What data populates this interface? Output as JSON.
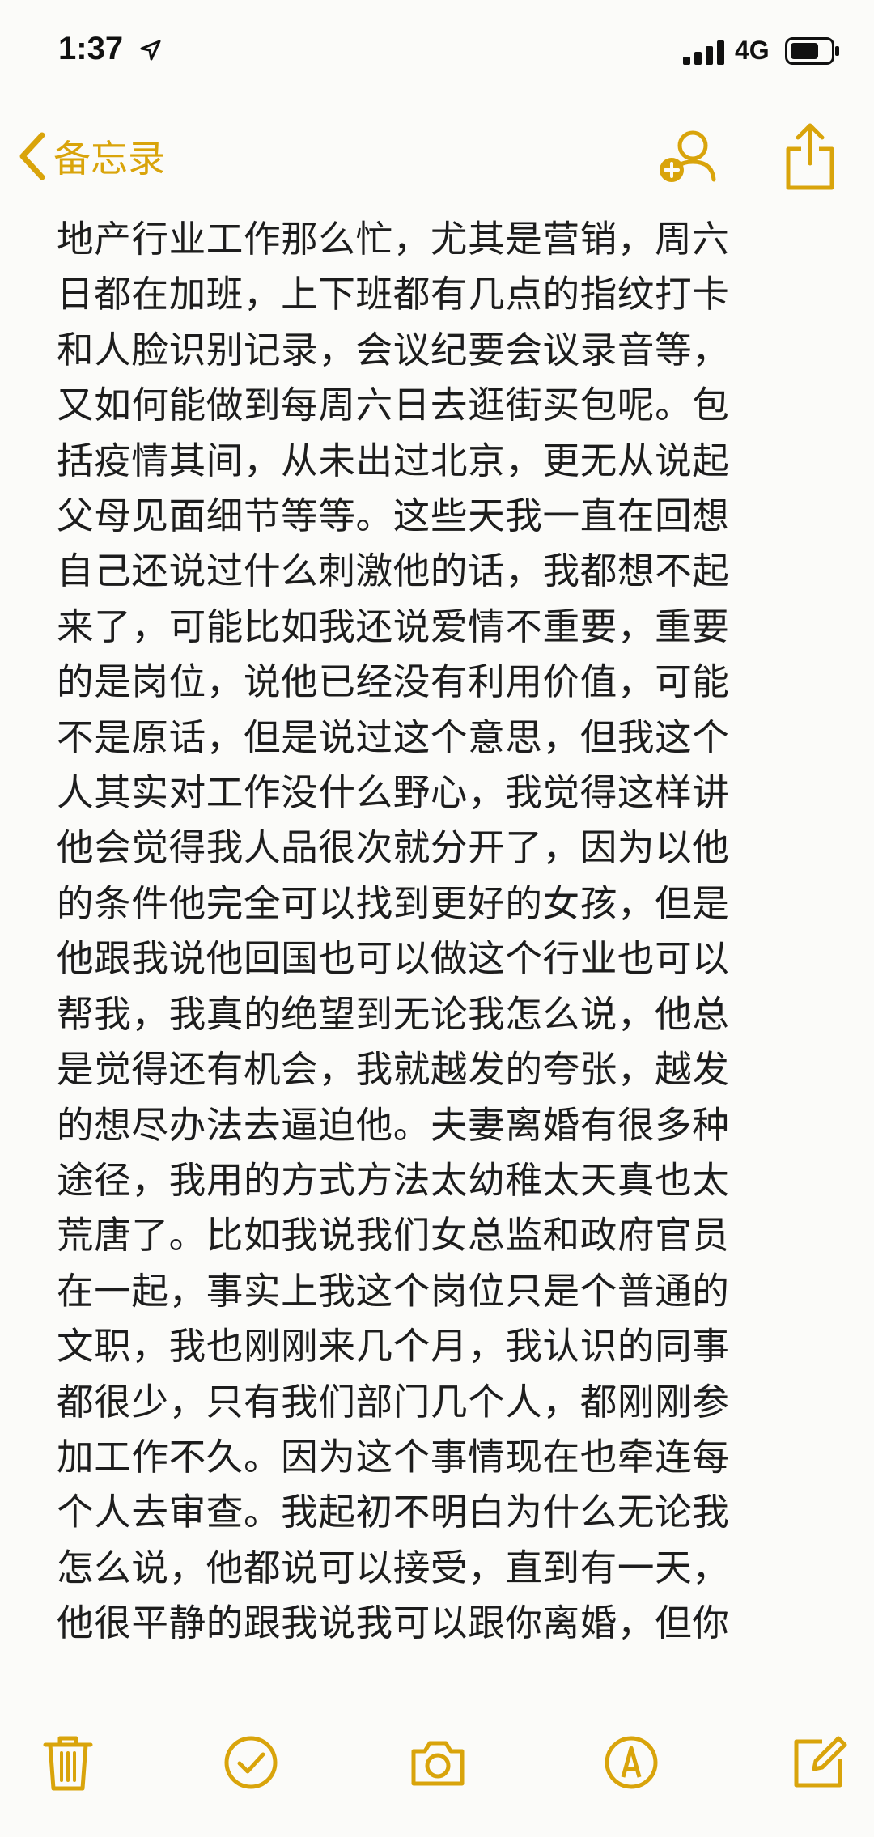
{
  "status_bar": {
    "time": "1:37",
    "network": "4G",
    "icons": [
      "location-arrow-icon",
      "signal-icon",
      "battery-icon"
    ]
  },
  "nav": {
    "back_label": "备忘录",
    "icons": [
      "chevron-left-icon",
      "add-person-icon",
      "share-icon"
    ]
  },
  "note": {
    "text": "地产行业工作那么忙，尤其是营销，周六\n日都在加班，上下班都有几点的指纹打卡\n和人脸识别记录，会议纪要会议录音等，\n又如何能做到每周六日去逛街买包呢。包\n括疫情其间，从未出过北京，更无从说起\n父母见面细节等等。这些天我一直在回想\n自己还说过什么刺激他的话，我都想不起\n来了，可能比如我还说爱情不重要，重要\n的是岗位，说他已经没有利用价值，可能\n不是原话，但是说过这个意思，但我这个\n人其实对工作没什么野心，我觉得这样讲\n他会觉得我人品很次就分开了，因为以他\n的条件他完全可以找到更好的女孩，但是\n他跟我说他回国也可以做这个行业也可以\n帮我，我真的绝望到无论我怎么说，他总\n是觉得还有机会，我就越发的夸张，越发\n的想尽办法去逼迫他。夫妻离婚有很多种\n途径，我用的方式方法太幼稚太天真也太\n荒唐了。比如我说我们女总监和政府官员\n在一起，事实上我这个岗位只是个普通的\n文职，我也刚刚来几个月，我认识的同事\n都很少，只有我们部门几个人，都刚刚参\n加工作不久。因为这个事情现在也牵连每\n个人去审查。我起初不明白为什么无论我\n怎么说，他都说可以接受，直到有一天，\n他很平静的跟我说我可以跟你离婚，但你"
  },
  "toolbar": {
    "icons": [
      "trash-icon",
      "checklist-icon",
      "camera-icon",
      "markup-icon",
      "compose-icon"
    ]
  },
  "colors": {
    "accent": "#d9a40b",
    "background": "#fbfbf9",
    "text": "#1d1d1d"
  }
}
